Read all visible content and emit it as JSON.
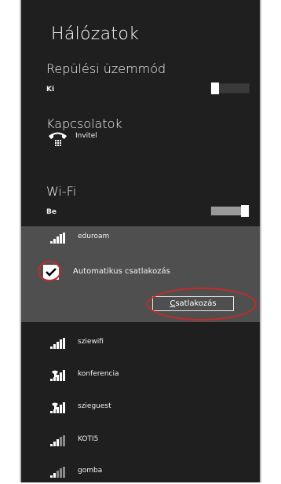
{
  "title": "Hálózatok",
  "airplane": {
    "label": "Repülési üzemmód",
    "state": "Ki",
    "on": false
  },
  "connections": {
    "label": "Kapcsolatok",
    "name": "Invitel"
  },
  "wifi": {
    "label": "Wi-Fi",
    "state": "Be",
    "on": true
  },
  "selected_network": {
    "name": "eduroam",
    "auto_connect_label": "Automatikus csatlakozás",
    "auto_connect_checked": true,
    "connect_button": {
      "access_key": "C",
      "rest": "satlakozás"
    }
  },
  "networks": [
    {
      "name": "sziewifi",
      "secured": false
    },
    {
      "name": "konferencia",
      "secured": true
    },
    {
      "name": "szieguest",
      "secured": true
    },
    {
      "name": "KOTI5",
      "secured": false
    },
    {
      "name": "gomba",
      "secured": false
    }
  ],
  "colors": {
    "panel_bg": "#1f1f1f",
    "selected_bg": "#4f4f4f",
    "highlight_ring": "#c32a2a"
  }
}
